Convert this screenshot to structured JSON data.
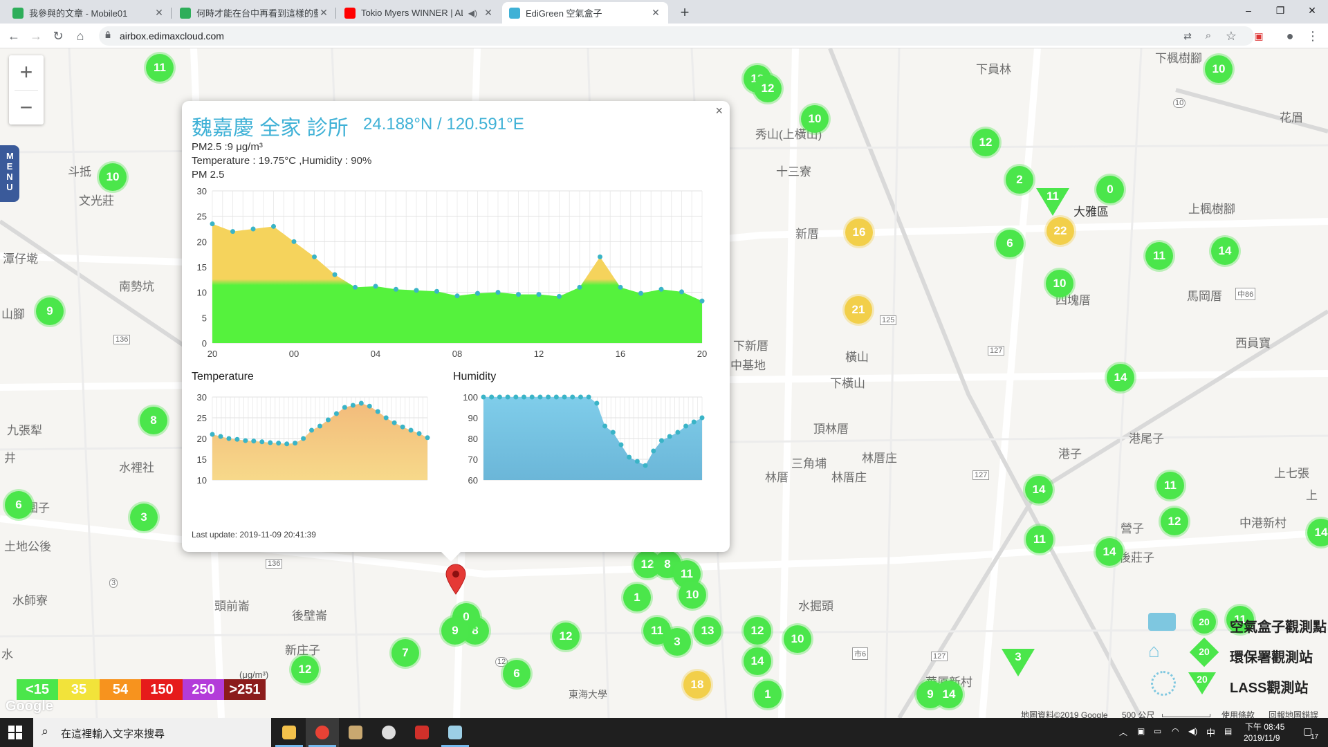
{
  "browser": {
    "tabs": [
      {
        "title": "我參與的文章 - Mobile01",
        "close": "✕",
        "icon_color": "#2eae5a"
      },
      {
        "title": "何時才能在台中再看到這樣的藍",
        "close": "✕",
        "icon_color": "#2eae5a"
      },
      {
        "title": "Tokio Myers WINNER | ALL",
        "close": "✕",
        "icon_color": "#ff0000"
      },
      {
        "title": "EdiGreen 空氣盒子",
        "close": "✕",
        "icon_color": "#3fb1d6"
      }
    ],
    "new_tab": "+",
    "url": "airbox.edimaxcloud.com",
    "window_controls": [
      "–",
      "❐",
      "✕"
    ]
  },
  "map": {
    "zoom_in": "+",
    "zoom_out": "−",
    "menu_label": "MENU",
    "places": [
      "下員林",
      "下楓樹腳",
      "秀山(上橫山)",
      "十三寮",
      "大雅區",
      "上楓樹腳",
      "斗抵",
      "文光莊",
      "潭仔墘",
      "南勢坑",
      "新厝",
      "山腳",
      "四塊厝",
      "馬岡厝",
      "西員寶",
      "下新厝",
      "中基地",
      "橫山",
      "下橫山",
      "頂林厝",
      "林厝庄",
      "三角埔",
      "林厝",
      "林厝庄",
      "港子",
      "港尾子",
      "九張犁",
      "水裡社",
      "上七張",
      "中港新村",
      "後莊子",
      "土地公後",
      "水師寮",
      "頭前崙",
      "後壁崙",
      "新庄子",
      "水掘頭",
      "華厦新村",
      "東海大學",
      "花眉",
      "營子",
      "圍子",
      "井",
      "水",
      "上"
    ],
    "markers": [
      {
        "v": "11",
        "c": "g"
      },
      {
        "v": "12",
        "c": "g"
      },
      {
        "v": "12",
        "c": "g"
      },
      {
        "v": "10",
        "c": "g"
      },
      {
        "v": "10",
        "c": "g"
      },
      {
        "v": "12",
        "c": "g"
      },
      {
        "v": "2",
        "c": "g"
      },
      {
        "v": "0",
        "c": "g"
      },
      {
        "v": "10",
        "c": "g"
      },
      {
        "v": "16",
        "c": "y"
      },
      {
        "v": "6",
        "c": "g"
      },
      {
        "v": "22",
        "c": "y"
      },
      {
        "v": "11",
        "c": "g"
      },
      {
        "v": "14",
        "c": "g"
      },
      {
        "v": "10",
        "c": "g"
      },
      {
        "v": "21",
        "c": "y"
      },
      {
        "v": "9",
        "c": "g"
      },
      {
        "v": "14",
        "c": "g"
      },
      {
        "v": "8",
        "c": "g"
      },
      {
        "v": "6",
        "c": "g"
      },
      {
        "v": "3",
        "c": "g"
      },
      {
        "v": "14",
        "c": "g"
      },
      {
        "v": "11",
        "c": "g"
      },
      {
        "v": "12",
        "c": "g"
      },
      {
        "v": "11",
        "c": "g"
      },
      {
        "v": "14",
        "c": "g"
      },
      {
        "v": "12",
        "c": "g"
      },
      {
        "v": "8",
        "c": "g"
      },
      {
        "v": "11",
        "c": "g"
      },
      {
        "v": "10",
        "c": "g"
      },
      {
        "v": "1",
        "c": "g"
      },
      {
        "v": "8",
        "c": "g"
      },
      {
        "v": "12",
        "c": "g"
      },
      {
        "v": "11",
        "c": "g"
      },
      {
        "v": "3",
        "c": "g"
      },
      {
        "v": "13",
        "c": "g"
      },
      {
        "v": "12",
        "c": "g"
      },
      {
        "v": "10",
        "c": "g"
      },
      {
        "v": "7",
        "c": "g"
      },
      {
        "v": "6",
        "c": "g"
      },
      {
        "v": "12",
        "c": "g"
      },
      {
        "v": "14",
        "c": "g"
      },
      {
        "v": "18",
        "c": "y"
      },
      {
        "v": "1",
        "c": "g"
      },
      {
        "v": "9",
        "c": "g"
      },
      {
        "v": "14",
        "c": "g"
      },
      {
        "v": "0",
        "c": "g"
      },
      {
        "v": "9",
        "c": "g"
      },
      {
        "v": "14",
        "c": "g"
      },
      {
        "v": "11",
        "c": "g"
      }
    ],
    "triangles": [
      "11",
      "3"
    ],
    "road_numbers": [
      "136",
      "136",
      "125",
      "127",
      "127",
      "127",
      "136",
      "10",
      "12",
      "市6",
      "中86",
      "3"
    ],
    "google_logo": "Google"
  },
  "popup": {
    "close": "×",
    "title": "魏嘉慶 全家 診所",
    "coord": "24.188°N / 120.591°E",
    "pm_line": "PM2.5 :9 μg/m³",
    "th_line": "Temperature : 19.75°C ,Humidity : 90%",
    "chart_caption": "PM 2.5",
    "temp_caption": "Temperature",
    "hum_caption": "Humidity",
    "last_update": "Last update: 2019-11-09 20:41:39"
  },
  "legend": {
    "scale": [
      {
        "label": "<15",
        "color": "#4be64b"
      },
      {
        "label": "35",
        "color": "#f2e33a"
      },
      {
        "label": "54",
        "color": "#f7931e"
      },
      {
        "label": "150",
        "color": "#e61b1b"
      },
      {
        "label": "250",
        "color": "#b33cd9"
      },
      {
        "label": ">251",
        "color": "#8b1c1c"
      }
    ],
    "unit": "(μg/m³)",
    "keys": [
      {
        "label": "空氣盒子觀測點",
        "badge": "20"
      },
      {
        "label": "環保署觀測站",
        "badge": "20"
      },
      {
        "label": "LASS觀測站",
        "badge": "20"
      }
    ],
    "footer": {
      "map_data": "地圖資料©2019 Google",
      "scale": "500 公尺",
      "terms": "使用條款",
      "report": "回報地圖錯誤"
    }
  },
  "taskbar": {
    "search_placeholder": "在這裡輸入文字來搜尋",
    "time": "下午 08:45",
    "date": "2019/11/9",
    "ime": "中",
    "notif_count": "17"
  },
  "chart_data": [
    {
      "type": "area",
      "title": "PM 2.5",
      "categories": [
        "20",
        "21",
        "22",
        "23",
        "00",
        "01",
        "02",
        "03",
        "04",
        "05",
        "06",
        "07",
        "08",
        "09",
        "10",
        "11",
        "12",
        "13",
        "14",
        "15",
        "16",
        "17",
        "18",
        "19",
        "20"
      ],
      "x_tick_labels": [
        "20",
        "00",
        "04",
        "08",
        "12",
        "16",
        "20"
      ],
      "ylim": [
        0,
        30
      ],
      "y_ticks": [
        0,
        5,
        10,
        15,
        20,
        25,
        30
      ],
      "series": [
        {
          "values": [
            23.5,
            22,
            22.5,
            23,
            20,
            17,
            13.5,
            11,
            11.2,
            10.6,
            10.4,
            10.2,
            9.3,
            9.8,
            10,
            9.6,
            9.6,
            9.2,
            11,
            17,
            11,
            9.8,
            10.6,
            10.1,
            8.3
          ]
        }
      ],
      "threshold": 12,
      "colors": {
        "below": "#55f23d",
        "above": "#f5d35c",
        "point": "#3ab4c7"
      }
    },
    {
      "type": "area",
      "title": "Temperature",
      "ylim": [
        10,
        30
      ],
      "y_ticks": [
        10,
        15,
        20,
        25,
        30
      ],
      "series": [
        {
          "values": [
            21,
            20.5,
            20,
            19.8,
            19.5,
            19.4,
            19.2,
            19,
            18.9,
            18.7,
            18.9,
            20,
            22,
            23,
            24.5,
            26,
            27.5,
            28,
            28.5,
            27.8,
            26.5,
            25,
            23.8,
            22.8,
            22,
            21.2,
            20.2
          ]
        }
      ],
      "colors": {
        "top": "#f2b97a",
        "bottom": "#f7d98a",
        "point": "#3ab4c7"
      }
    },
    {
      "type": "area",
      "title": "Humidity",
      "ylim": [
        60,
        100
      ],
      "y_ticks": [
        60,
        70,
        80,
        90,
        100
      ],
      "series": [
        {
          "values": [
            100,
            100,
            100,
            100,
            100,
            100,
            100,
            100,
            100,
            100,
            100,
            100,
            100,
            100,
            97,
            86,
            83,
            77,
            71,
            69,
            67,
            74,
            79,
            81,
            83,
            86,
            88,
            90
          ]
        }
      ],
      "colors": {
        "top": "#7fcdea",
        "bottom": "#6bb6d8",
        "point": "#3ab4c7"
      }
    }
  ]
}
